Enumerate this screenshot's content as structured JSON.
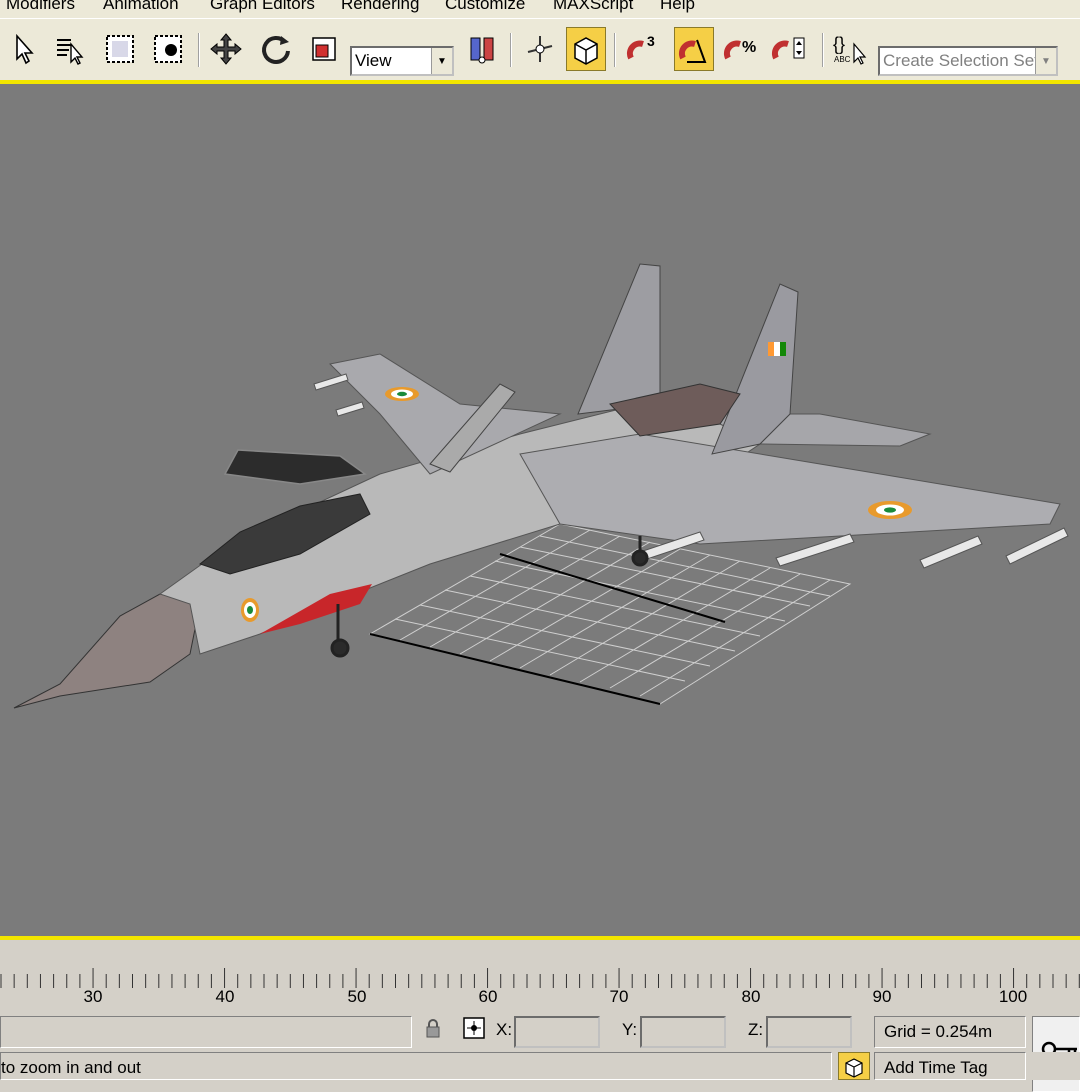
{
  "menu": {
    "items": [
      "Modifiers",
      "Animation",
      "Graph Editors",
      "Rendering",
      "Customize",
      "MAXScript",
      "Help"
    ]
  },
  "toolbar": {
    "buttons": [
      "select-object",
      "select-by-name",
      "rectangular-selection-region",
      "window-crossing",
      "select-and-move",
      "select-and-rotate",
      "select-and-scale",
      "select-and-manipulate",
      "use-pivot-point-center",
      "angle-snap",
      "snaps-toggle",
      "percent-snap",
      "spinner-snap",
      "edit-named-selection-sets"
    ],
    "coordinate_system": "View",
    "named_selection_placeholder": "Create Selection Set",
    "active_color": "#f5cf46"
  },
  "viewport": {
    "background": "#7b7b7b",
    "active_border_color": "#f2e600"
  },
  "timeline": {
    "tick_labels": [
      "30",
      "40",
      "50",
      "60",
      "70",
      "80",
      "90",
      "100"
    ]
  },
  "status": {
    "x_label": "X:",
    "y_label": "Y:",
    "z_label": "Z:",
    "x_value": "",
    "y_value": "",
    "z_value": "",
    "grid": "Grid = 0.254m",
    "prompt": "to zoom in and out",
    "add_time_tag": "Add Time Tag"
  }
}
